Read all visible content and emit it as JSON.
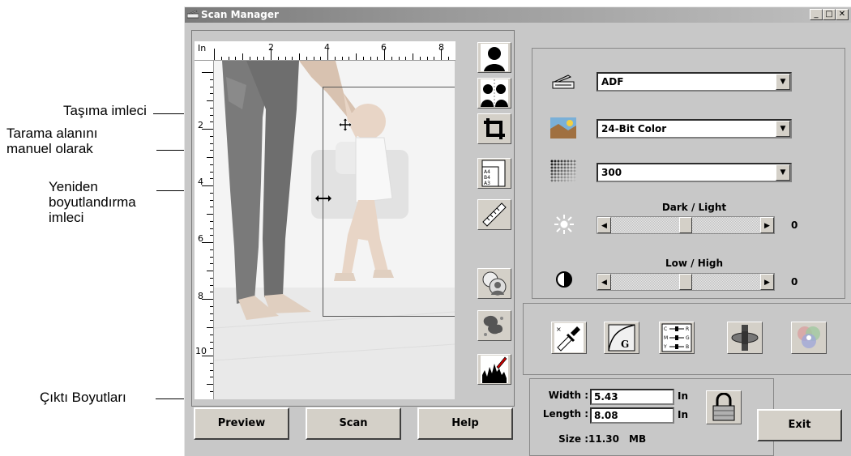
{
  "window": {
    "title": "Scan Manager",
    "minimize": "_",
    "maximize": "□",
    "close": "✕"
  },
  "callouts": {
    "move_cursor": "Taşıma imleci",
    "manual_area_line1": "Tarama alanını",
    "manual_area_line2": "manuel olarak",
    "resize_line1": "Yeniden",
    "resize_line2": "boyutlandırma",
    "resize_line3": "imleci",
    "output_size": "Çıktı Boyutları"
  },
  "ruler": {
    "unit": "In",
    "top_labels": [
      "2",
      "4",
      "6",
      "8"
    ],
    "left_labels": [
      "2",
      "4",
      "6",
      "8",
      "10"
    ]
  },
  "tools": [
    "portrait-tool-icon",
    "mirror-tool-icon",
    "crop-icon",
    "paper-size-icon",
    "ruler-icon",
    "auto-enhance-icon",
    "descreen-icon",
    "histogram-icon"
  ],
  "paper_sizes": [
    "A4",
    "B4",
    "A3"
  ],
  "settings": {
    "source": "ADF",
    "color_mode": "24-Bit Color",
    "resolution": "300",
    "brightness_label": "Dark / Light",
    "brightness_value": "0",
    "brightness_level": 0.5,
    "contrast_label": "Low / High",
    "contrast_value": "0",
    "contrast_level": 0.5
  },
  "output": {
    "width_label": "Width :",
    "width_value": "5.43",
    "length_label": "Length :",
    "length_value": "8.08",
    "unit": "In",
    "size_label": "Size :",
    "size_value": "11.30",
    "size_unit": "MB"
  },
  "buttons": {
    "preview": "Preview",
    "scan": "Scan",
    "help": "Help",
    "exit": "Exit"
  }
}
